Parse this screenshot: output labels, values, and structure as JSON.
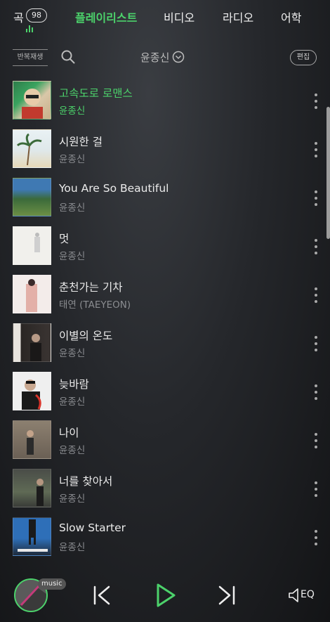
{
  "tabs": {
    "song_label": "곡",
    "song_count": "98",
    "playlist": "플레이리스트",
    "video": "비디오",
    "radio": "라디오",
    "language": "어학"
  },
  "toolbar": {
    "repeat_label": "반복재생",
    "artist_filter": "윤종신",
    "edit_label": "편집"
  },
  "songs": [
    {
      "title": "고속도로 로맨스",
      "artist": "윤종신",
      "playing": true
    },
    {
      "title": "시원한 걸",
      "artist": "윤종신"
    },
    {
      "title": "You Are So Beautiful",
      "artist": "윤종신"
    },
    {
      "title": "멋",
      "artist": "윤종신"
    },
    {
      "title": "춘천가는 기차",
      "artist": "태연 (TAEYEON)"
    },
    {
      "title": "이별의 온도",
      "artist": "윤종신"
    },
    {
      "title": "늦바람",
      "artist": "윤종신"
    },
    {
      "title": "나이",
      "artist": "윤종신"
    },
    {
      "title": "너를 찾아서",
      "artist": "윤종신"
    },
    {
      "title": "Slow Starter",
      "artist": "윤종신"
    }
  ],
  "player": {
    "music_tag": "music",
    "eq_label": "EQ"
  },
  "colors": {
    "accent": "#4cd26b",
    "background": "#222428",
    "secondary_text": "#8a8c90"
  }
}
